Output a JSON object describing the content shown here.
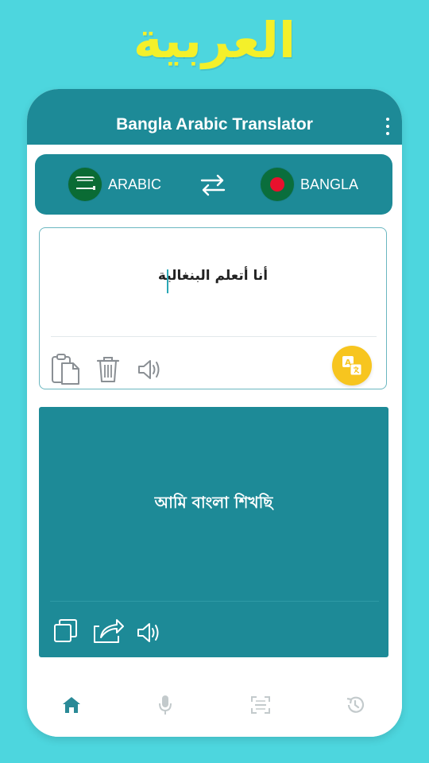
{
  "promo": {
    "title": "العربية"
  },
  "app": {
    "title": "Bangla Arabic Translator",
    "menu_icon": "kebab-menu-icon"
  },
  "languages": {
    "source": {
      "label": "ARABIC",
      "flag": "saudi-arabia-flag"
    },
    "target": {
      "label": "BANGLA",
      "flag": "bangladesh-flag"
    },
    "swap_icon": "swap-arrows-icon"
  },
  "input": {
    "text": "أنا أتعلم البنغالية",
    "tools": [
      "paste-icon",
      "delete-icon",
      "speaker-icon"
    ],
    "translate_icon": "translate-icon"
  },
  "output": {
    "text": "আমি বাংলা শিখছি",
    "tools": [
      "copy-icon",
      "share-icon",
      "speaker-icon"
    ]
  },
  "bottom_nav": {
    "items": [
      {
        "name": "home",
        "icon": "home-icon",
        "active": true
      },
      {
        "name": "voice",
        "icon": "microphone-icon",
        "active": false
      },
      {
        "name": "scan",
        "icon": "scan-icon",
        "active": false
      },
      {
        "name": "history",
        "icon": "history-icon",
        "active": false
      }
    ]
  },
  "colors": {
    "background": "#4dd6de",
    "primary": "#1d8a97",
    "promo_text": "#f4f02a",
    "fab": "#f7c51f",
    "nav_active": "#2a8a97",
    "nav_inactive": "#c3cacc"
  }
}
